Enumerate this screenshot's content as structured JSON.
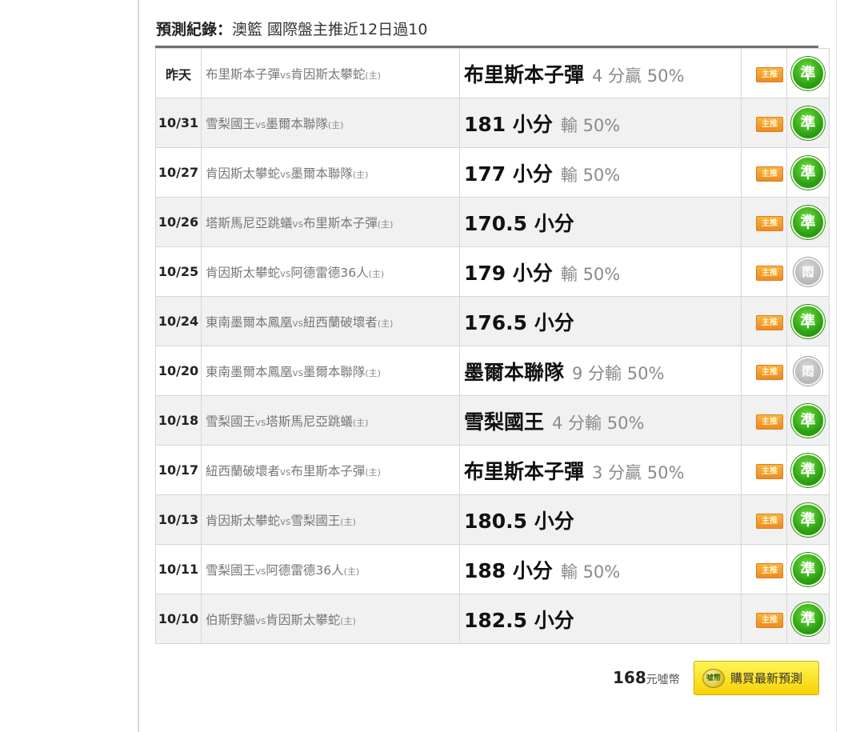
{
  "header": {
    "label": "預測紀錄：",
    "title": "澳籃 國際盤主推近12日過10"
  },
  "records": [
    {
      "date": "昨天",
      "away": "布里斯本子彈",
      "vs": "vs",
      "home": "肯因斯太攀蛇",
      "home_mark": "(主)",
      "pick": "布里斯本子彈",
      "detail": "4 分贏 50%",
      "tag": "主推",
      "result": "準",
      "result_type": "good"
    },
    {
      "date": "10/31",
      "away": "雪梨國王",
      "vs": "vs",
      "home": "墨爾本聯隊",
      "home_mark": "(主)",
      "pick": "181 小分",
      "detail": "輸 50%",
      "tag": "主推",
      "result": "準",
      "result_type": "good"
    },
    {
      "date": "10/27",
      "away": "肯因斯太攀蛇",
      "vs": "vs",
      "home": "墨爾本聯隊",
      "home_mark": "(主)",
      "pick": "177 小分",
      "detail": "輸 50%",
      "tag": "主推",
      "result": "準",
      "result_type": "good"
    },
    {
      "date": "10/26",
      "away": "塔斯馬尼亞跳蟻",
      "vs": "vs",
      "home": "布里斯本子彈",
      "home_mark": "(主)",
      "pick": "170.5 小分",
      "detail": "",
      "tag": "主推",
      "result": "準",
      "result_type": "good"
    },
    {
      "date": "10/25",
      "away": "肯因斯太攀蛇",
      "vs": "vs",
      "home": "阿德雷德36人",
      "home_mark": "(主)",
      "pick": "179 小分",
      "detail": "輸 50%",
      "tag": "主推",
      "result": "悶",
      "result_type": "neutral"
    },
    {
      "date": "10/24",
      "away": "東南墨爾本鳳凰",
      "vs": "vs",
      "home": "紐西蘭破壞者",
      "home_mark": "(主)",
      "pick": "176.5 小分",
      "detail": "",
      "tag": "主推",
      "result": "準",
      "result_type": "good"
    },
    {
      "date": "10/20",
      "away": "東南墨爾本鳳凰",
      "vs": "vs",
      "home": "墨爾本聯隊",
      "home_mark": "(主)",
      "pick": "墨爾本聯隊",
      "detail": "9 分輸 50%",
      "tag": "主推",
      "result": "悶",
      "result_type": "neutral"
    },
    {
      "date": "10/18",
      "away": "雪梨國王",
      "vs": "vs",
      "home": "塔斯馬尼亞跳蟻",
      "home_mark": "(主)",
      "pick": "雪梨國王",
      "detail": "4 分輸 50%",
      "tag": "主推",
      "result": "準",
      "result_type": "good"
    },
    {
      "date": "10/17",
      "away": "紐西蘭破壞者",
      "vs": "vs",
      "home": "布里斯本子彈",
      "home_mark": "(主)",
      "pick": "布里斯本子彈",
      "detail": "3 分贏 50%",
      "tag": "主推",
      "result": "準",
      "result_type": "good"
    },
    {
      "date": "10/13",
      "away": "肯因斯太攀蛇",
      "vs": "vs",
      "home": "雪梨國王",
      "home_mark": "(主)",
      "pick": "180.5 小分",
      "detail": "",
      "tag": "主推",
      "result": "準",
      "result_type": "good"
    },
    {
      "date": "10/11",
      "away": "雪梨國王",
      "vs": "vs",
      "home": "阿德雷德36人",
      "home_mark": "(主)",
      "pick": "188 小分",
      "detail": "輸 50%",
      "tag": "主推",
      "result": "準",
      "result_type": "good"
    },
    {
      "date": "10/10",
      "away": "伯斯野貓",
      "vs": "vs",
      "home": "肯因斯太攀蛇",
      "home_mark": "(主)",
      "pick": "182.5 小分",
      "detail": "",
      "tag": "主推",
      "result": "準",
      "result_type": "good"
    }
  ],
  "footer": {
    "price": "168",
    "price_unit": "元噓幣",
    "coin_icon_text": "噓幣",
    "buy_label": "購買最新預測"
  }
}
